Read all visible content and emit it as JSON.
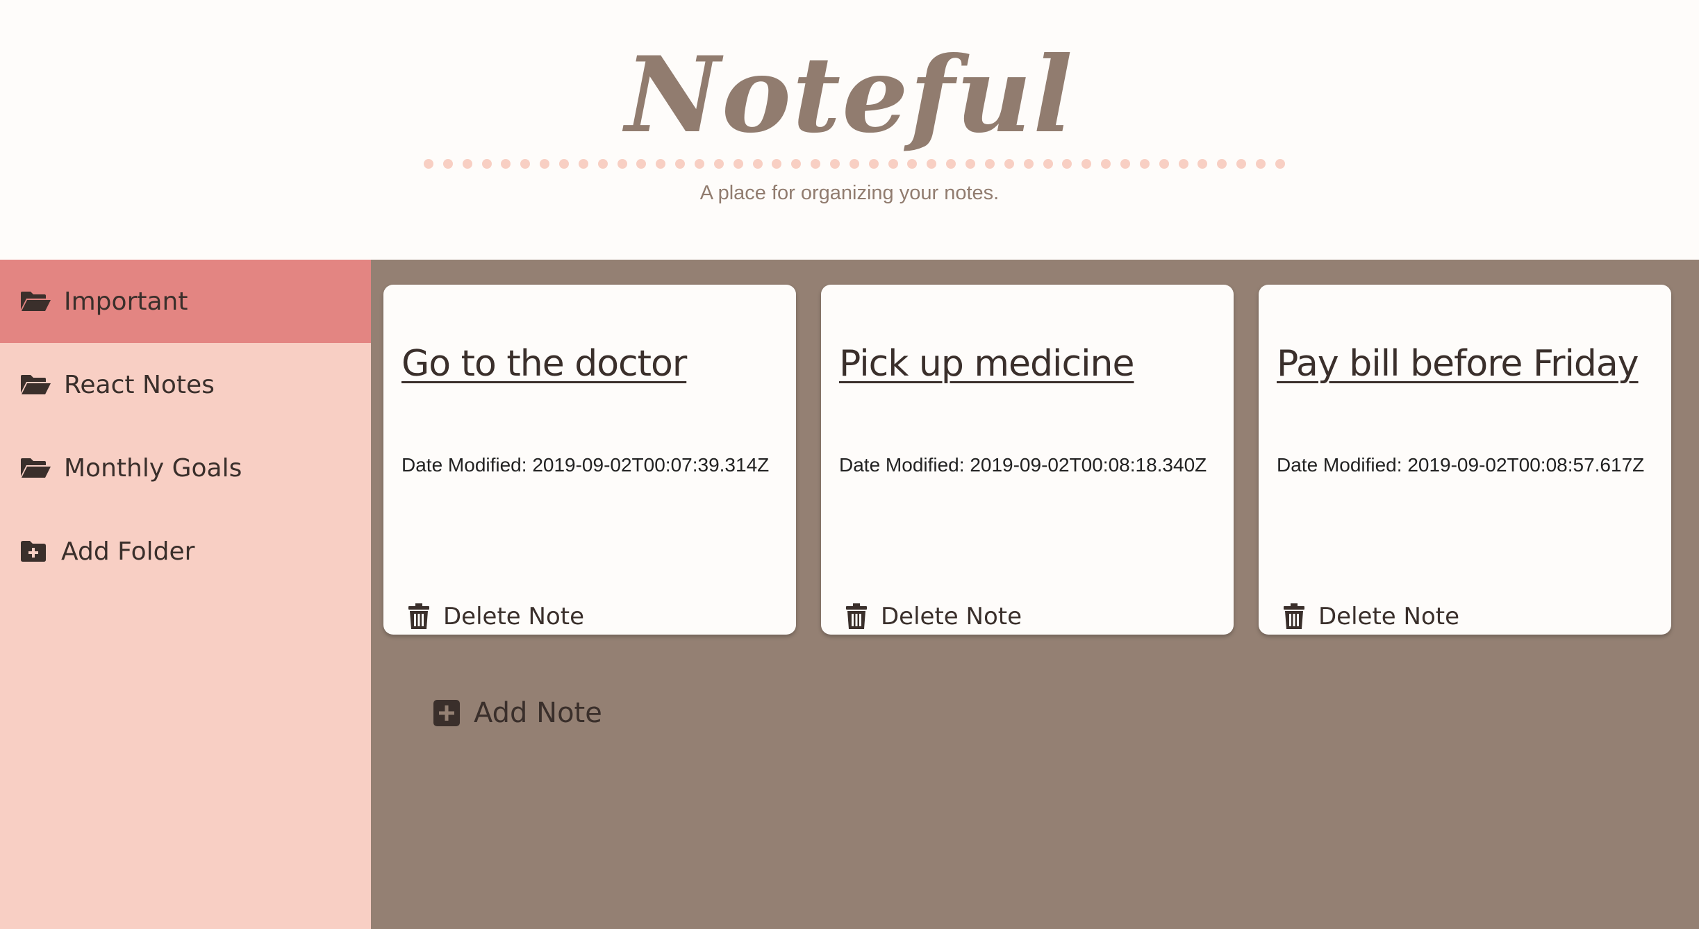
{
  "header": {
    "title": "Noteful",
    "tagline": "A place for organizing your notes."
  },
  "sidebar": {
    "folders": [
      {
        "label": "Important",
        "icon": "folder-open-icon",
        "active": true
      },
      {
        "label": "React Notes",
        "icon": "folder-open-icon",
        "active": false
      },
      {
        "label": "Monthly Goals",
        "icon": "folder-open-icon",
        "active": false
      }
    ],
    "add_folder_label": "Add Folder",
    "add_folder_icon": "folder-plus-icon"
  },
  "notes": [
    {
      "title": "Go to the doctor",
      "date_label": "Date Modified: 2019-09-02T00:07:39.314Z",
      "delete_label": "Delete Note"
    },
    {
      "title": "Pick up medicine",
      "date_label": "Date Modified: 2019-09-02T00:08:18.340Z",
      "delete_label": "Delete Note"
    },
    {
      "title": "Pay bill before Friday",
      "date_label": "Date Modified: 2019-09-02T00:08:57.617Z",
      "delete_label": "Delete Note"
    }
  ],
  "add_note_label": "Add Note",
  "colors": {
    "header_bg": "#fefcfa",
    "brand": "#917c6f",
    "dots": "#f8cfc3",
    "sidebar_bg": "#f8cfc4",
    "sidebar_active": "#e38582",
    "main_bg": "#948073",
    "card_bg": "#fefcfa",
    "text_dark": "#3a2f2b"
  }
}
